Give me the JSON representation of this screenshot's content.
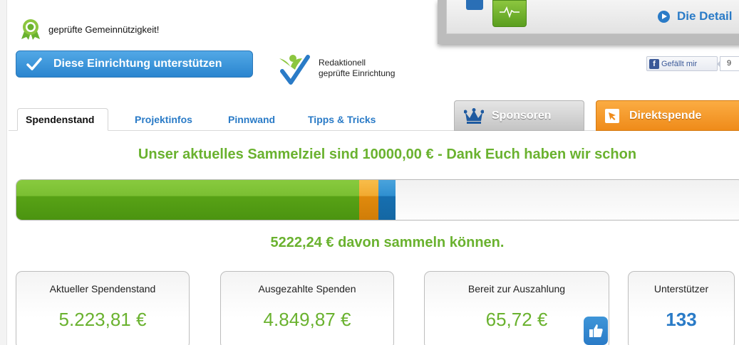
{
  "seal": {
    "text": "geprüfte Gemeinnützigkeit!",
    "icon": "award-seal-icon"
  },
  "support_button": {
    "label": "Diese Einrichtung unterstützen",
    "icon": "checkmark-icon"
  },
  "editorial": {
    "line1": "Redaktionell",
    "line2": "geprüfte Einrichtung",
    "icon": "editorial-check-icon"
  },
  "popup": {
    "details_label": "Die Detail"
  },
  "facebook": {
    "like_label": "Gefällt mir",
    "count": "9"
  },
  "tabs": [
    {
      "label": "Spendenstand",
      "active": true
    },
    {
      "label": "Projektinfos"
    },
    {
      "label": "Pinnwand"
    },
    {
      "label": "Tipps & Tricks"
    }
  ],
  "sponsor_tab": {
    "label": "Sponsoren",
    "icon": "crown-icon"
  },
  "direct_tab": {
    "label": "Direktspende",
    "icon": "cursor-arrow-icon"
  },
  "goal": {
    "text": "Unser aktuelles Sammelziel sind 10000,00 € - Dank Euch haben wir schon",
    "collected_text": "5222,24 € davon sammeln können.",
    "progress_green": 0.472,
    "progress_orange": 0.026,
    "progress_blue": 0.024
  },
  "stats": [
    {
      "label": "Aktueller Spendenstand",
      "value": "5.223,81 €"
    },
    {
      "label": "Ausgezahlte Spenden",
      "value": "4.849,87 €"
    },
    {
      "label": "Bereit zur Auszahlung",
      "value": "65,72 €"
    },
    {
      "label": "Unterstützer",
      "value": "133"
    }
  ],
  "colors": {
    "accent_green": "#6ab22f",
    "accent_blue": "#2a7bc7",
    "accent_orange": "#f39a26"
  }
}
